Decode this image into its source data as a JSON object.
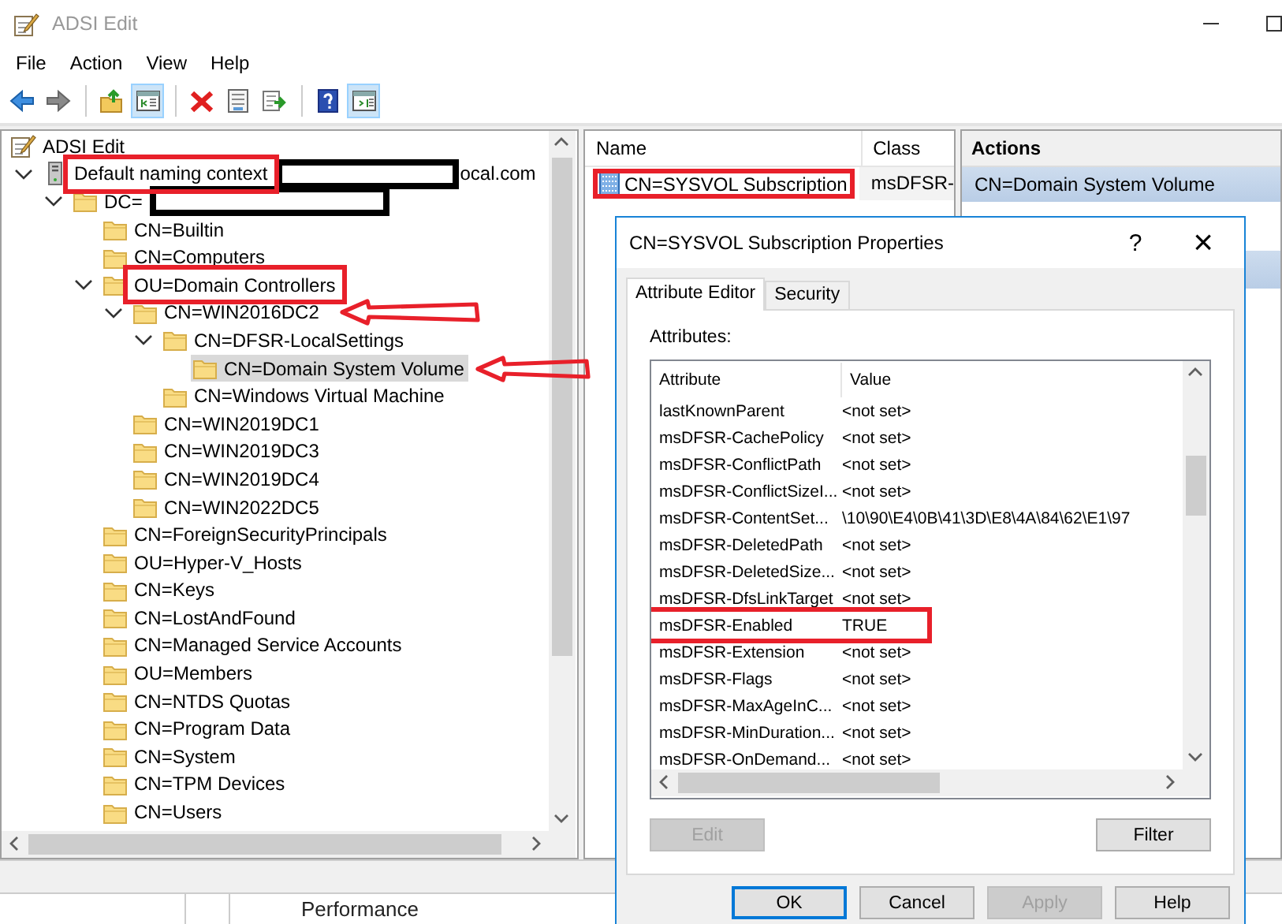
{
  "window": {
    "title": "ADSI Edit"
  },
  "menu": [
    "File",
    "Action",
    "View",
    "Help"
  ],
  "toolbar_buttons": [
    {
      "kind": "back",
      "pressed": false
    },
    {
      "kind": "forward",
      "pressed": false
    },
    {
      "kind": "separator"
    },
    {
      "kind": "up",
      "pressed": false
    },
    {
      "kind": "console-tree",
      "pressed": true
    },
    {
      "kind": "separator"
    },
    {
      "kind": "delete",
      "pressed": false
    },
    {
      "kind": "properties",
      "pressed": false
    },
    {
      "kind": "export",
      "pressed": false
    },
    {
      "kind": "separator"
    },
    {
      "kind": "help",
      "pressed": false
    },
    {
      "kind": "action-pane",
      "pressed": true
    }
  ],
  "tree": {
    "label": "ADSI Edit",
    "kind": "app",
    "selected": false,
    "children": [
      {
        "label": "Default naming context",
        "kind": "server",
        "expanded": true,
        "selected": false,
        "annotated": true,
        "redacted": true,
        "suffix": "ocal.com",
        "children": [
          {
            "label": "DC=",
            "kind": "folder",
            "expanded": true,
            "selected": false,
            "redacted": true,
            "children": [
              {
                "label": "CN=Builtin",
                "kind": "folder",
                "selected": false
              },
              {
                "label": "CN=Computers",
                "kind": "folder",
                "selected": false
              },
              {
                "label": "OU=Domain Controllers",
                "kind": "folder",
                "expanded": true,
                "selected": false,
                "annotated": true,
                "children": [
                  {
                    "label": "CN=WIN2016DC2",
                    "kind": "folder",
                    "expanded": true,
                    "selected": false,
                    "arrow": true,
                    "children": [
                      {
                        "label": "CN=DFSR-LocalSettings",
                        "kind": "folder",
                        "expanded": true,
                        "selected": false,
                        "children": [
                          {
                            "label": "CN=Domain System Volume",
                            "kind": "folder",
                            "selected": true,
                            "arrow": true
                          }
                        ]
                      },
                      {
                        "label": "CN=Windows Virtual Machine",
                        "kind": "folder",
                        "selected": false
                      }
                    ]
                  },
                  {
                    "label": "CN=WIN2019DC1",
                    "kind": "folder",
                    "selected": false
                  },
                  {
                    "label": "CN=WIN2019DC3",
                    "kind": "folder",
                    "selected": false
                  },
                  {
                    "label": "CN=WIN2019DC4",
                    "kind": "folder",
                    "selected": false
                  },
                  {
                    "label": "CN=WIN2022DC5",
                    "kind": "folder",
                    "selected": false
                  }
                ]
              },
              {
                "label": "CN=ForeignSecurityPrincipals",
                "kind": "folder",
                "selected": false
              },
              {
                "label": "OU=Hyper-V_Hosts",
                "kind": "folder",
                "selected": false
              },
              {
                "label": "CN=Keys",
                "kind": "folder",
                "selected": false
              },
              {
                "label": "CN=LostAndFound",
                "kind": "folder",
                "selected": false
              },
              {
                "label": "CN=Managed Service Accounts",
                "kind": "folder",
                "selected": false
              },
              {
                "label": "OU=Members",
                "kind": "folder",
                "selected": false
              },
              {
                "label": "CN=NTDS Quotas",
                "kind": "folder",
                "selected": false
              },
              {
                "label": "CN=Program Data",
                "kind": "folder",
                "selected": false
              },
              {
                "label": "CN=System",
                "kind": "folder",
                "selected": false
              },
              {
                "label": "CN=TPM Devices",
                "kind": "folder",
                "selected": false
              },
              {
                "label": "CN=Users",
                "kind": "folder",
                "selected": false
              }
            ]
          }
        ]
      }
    ]
  },
  "list": {
    "columns": [
      "Name",
      "Class"
    ],
    "rows": [
      {
        "name": "CN=SYSVOL Subscription",
        "class": "msDFSR-",
        "annotated": true
      }
    ]
  },
  "actions": {
    "header": "Actions",
    "items": [
      {
        "label": "CN=Domain System Volume"
      }
    ]
  },
  "dialog": {
    "title": "CN=SYSVOL Subscription Properties",
    "help": "?",
    "close": "×",
    "tabs": [
      {
        "label": "Attribute Editor",
        "selected": true
      },
      {
        "label": "Security",
        "selected": false
      }
    ],
    "attributes_label": "Attributes:",
    "columns": [
      "Attribute",
      "Value"
    ],
    "rows": [
      {
        "attribute": "lastKnownParent",
        "value": "<not set>",
        "annotated": false
      },
      {
        "attribute": "msDFSR-CachePolicy",
        "value": "<not set>",
        "annotated": false
      },
      {
        "attribute": "msDFSR-ConflictPath",
        "value": "<not set>",
        "annotated": false
      },
      {
        "attribute": "msDFSR-ConflictSizeI...",
        "value": "<not set>",
        "annotated": false
      },
      {
        "attribute": "msDFSR-ContentSet...",
        "value": "\\10\\90\\E4\\0B\\41\\3D\\E8\\4A\\84\\62\\E1\\97",
        "annotated": false
      },
      {
        "attribute": "msDFSR-DeletedPath",
        "value": "<not set>",
        "annotated": false
      },
      {
        "attribute": "msDFSR-DeletedSize...",
        "value": "<not set>",
        "annotated": false
      },
      {
        "attribute": "msDFSR-DfsLinkTarget",
        "value": "<not set>",
        "annotated": false
      },
      {
        "attribute": "msDFSR-Enabled",
        "value": "TRUE",
        "annotated": true
      },
      {
        "attribute": "msDFSR-Extension",
        "value": "<not set>",
        "annotated": false
      },
      {
        "attribute": "msDFSR-Flags",
        "value": "<not set>",
        "annotated": false
      },
      {
        "attribute": "msDFSR-MaxAgeInC...",
        "value": "<not set>",
        "annotated": false
      },
      {
        "attribute": "msDFSR-MinDuration...",
        "value": "<not set>",
        "annotated": false
      },
      {
        "attribute": "msDFSR-OnDemand...",
        "value": "<not set>",
        "annotated": false
      }
    ],
    "edit_button": {
      "label": "Edit",
      "disabled": true
    },
    "filter_button": {
      "label": "Filter",
      "disabled": false
    },
    "buttons": [
      {
        "label": "OK",
        "default": true,
        "disabled": false
      },
      {
        "label": "Cancel",
        "default": false,
        "disabled": false
      },
      {
        "label": "Apply",
        "default": false,
        "disabled": true
      },
      {
        "label": "Help",
        "default": false,
        "disabled": false
      }
    ]
  },
  "status_bar": {
    "text": "Performance"
  }
}
